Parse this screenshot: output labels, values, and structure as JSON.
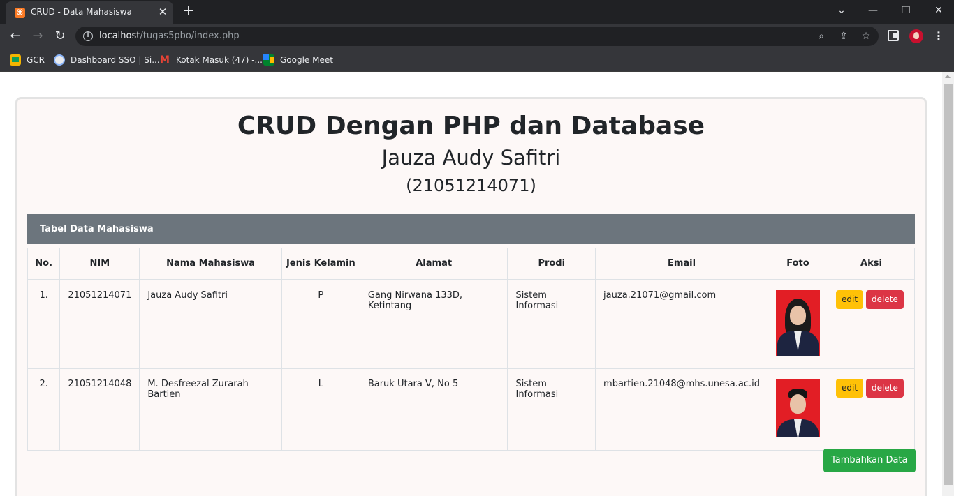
{
  "browser": {
    "tab_title": "CRUD - Data Mahasiswa",
    "url_host": "localhost",
    "url_path": "/tugas5pbo/index.php",
    "bookmarks": [
      {
        "label": "GCR",
        "icon": "classroom-icon"
      },
      {
        "label": "Dashboard SSO | Si...",
        "icon": "sso-icon"
      },
      {
        "label": "Kotak Masuk (47) -...",
        "icon": "gmail-icon"
      },
      {
        "label": "Google Meet",
        "icon": "meet-icon"
      }
    ]
  },
  "page": {
    "title": "CRUD Dengan PHP dan Database",
    "author": "Jauza Audy Safitri",
    "author_nim": "(21051214071)",
    "panel_title": "Tabel Data Mahasiswa",
    "add_button": "Tambahkan Data"
  },
  "table": {
    "headers": [
      "No.",
      "NIM",
      "Nama Mahasiswa",
      "Jenis Kelamin",
      "Alamat",
      "Prodi",
      "Email",
      "Foto",
      "Aksi"
    ],
    "rows": [
      {
        "no": "1.",
        "nim": "21051214071",
        "nama": "Jauza Audy Safitri",
        "jk": "P",
        "alamat": "Gang Nirwana 133D, Ketintang",
        "prodi": "Sistem Informasi",
        "email": "jauza.21071@gmail.com",
        "edit": "edit",
        "delete": "delete"
      },
      {
        "no": "2.",
        "nim": "21051214048",
        "nama": "M. Desfreezal Zurarah Bartien",
        "jk": "L",
        "alamat": "Baruk Utara V, No 5",
        "prodi": "Sistem Informasi",
        "email": "mbartien.21048@mhs.unesa.ac.id",
        "edit": "edit",
        "delete": "delete"
      }
    ]
  },
  "colors": {
    "panel_header": "#6c757d",
    "edit_button": "#ffc107",
    "delete_button": "#dc3545",
    "add_button": "#28a745",
    "card_background": "#fdf8f7"
  }
}
